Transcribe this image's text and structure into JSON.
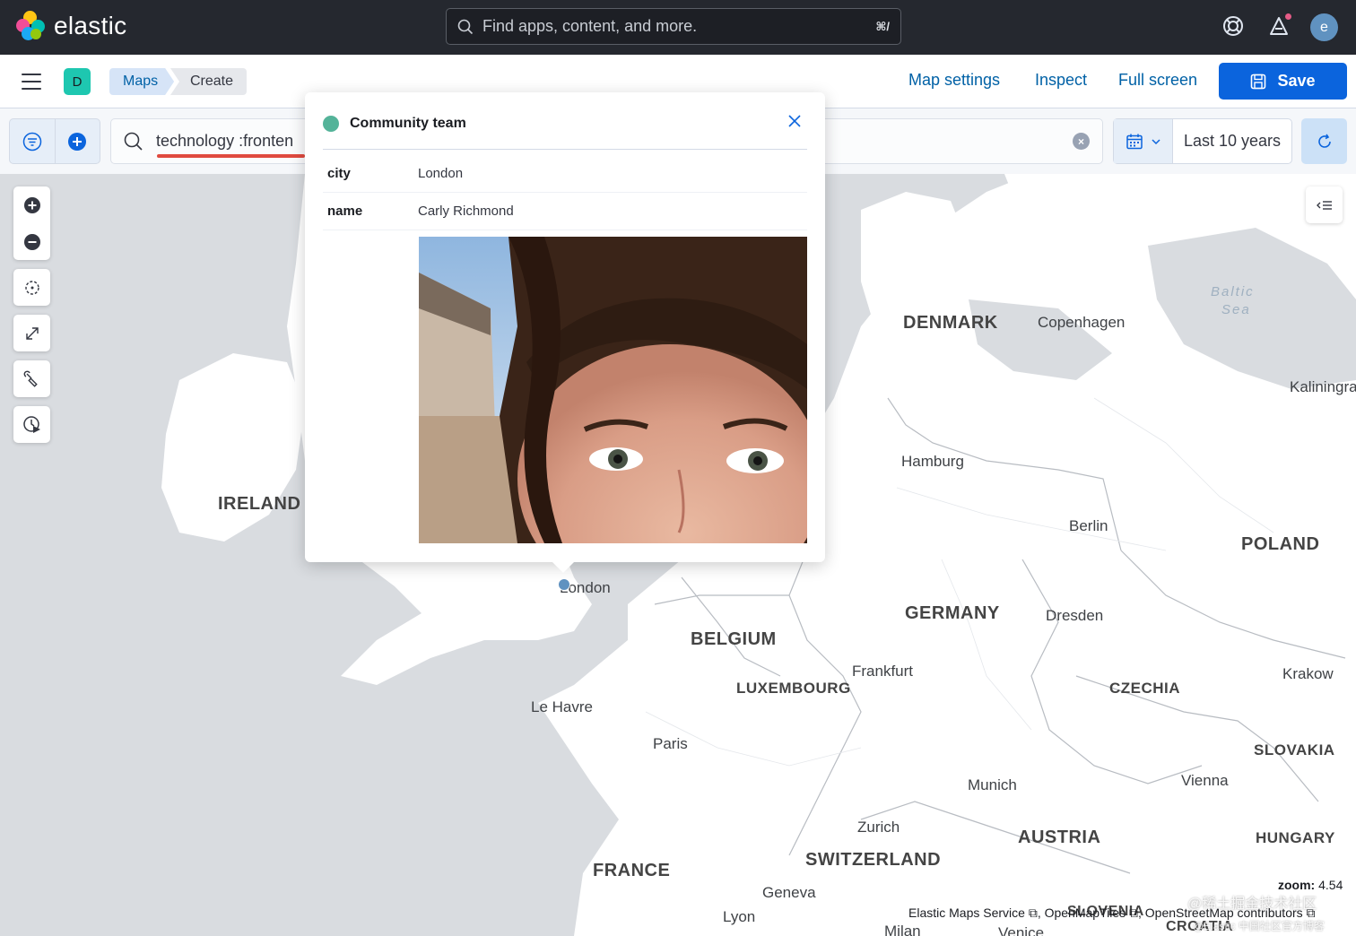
{
  "header": {
    "brand": "elastic",
    "search_placeholder": "Find apps, content, and more.",
    "search_shortcut": "⌘/",
    "avatar_initial": "e"
  },
  "nav": {
    "space_initial": "D",
    "breadcrumbs": [
      "Maps",
      "Create"
    ],
    "links": {
      "map_settings": "Map settings",
      "inspect": "Inspect",
      "full_screen": "Full screen"
    },
    "save_label": "Save"
  },
  "query": {
    "text": "technology :fronten",
    "date_range": "Last 10 years"
  },
  "map": {
    "labels": {
      "countries": {
        "denmark": "DENMARK",
        "ireland": "IRELAND",
        "poland": "POLAND",
        "germany": "GERMANY",
        "belgium": "BELGIUM",
        "luxembourg": "LUXEMBOURG",
        "czechia": "CZECHIA",
        "slovakia": "SLOVAKIA",
        "austria": "AUSTRIA",
        "hungary": "HUNGARY",
        "switzerland": "SWITZERLAND",
        "france": "FRANCE",
        "slovenia": "SLOVENIA",
        "croatia": "CROATIA"
      },
      "cities": {
        "copenhagen": "Copenhagen",
        "kaliningrad": "Kaliningra",
        "hamburg": "Hamburg",
        "berlin": "Berlin",
        "london": "London",
        "dresden": "Dresden",
        "frankfurt": "Frankfurt",
        "krakow": "Krakow",
        "le_havre": "Le Havre",
        "paris": "Paris",
        "munich": "Munich",
        "vienna": "Vienna",
        "zurich": "Zurich",
        "geneva": "Geneva",
        "lyon": "Lyon",
        "milan": "Milan",
        "venice": "Venice"
      },
      "sea_line1": "Baltic",
      "sea_line2": "Sea"
    },
    "zoom_label": "zoom:",
    "zoom_value": "4.54",
    "attribution": "Elastic Maps Service ⧉, OpenMapTiles ⧉, OpenStreetMap contributors ⧉",
    "watermark_line1": "@稀土掘金技术社区",
    "watermark_line2": "@Elastic 中国社区官方博客"
  },
  "popup": {
    "title": "Community team",
    "rows": [
      {
        "key": "city",
        "value": "London"
      },
      {
        "key": "name",
        "value": "Carly Richmond"
      }
    ],
    "legend_color": "#54b399"
  },
  "colors": {
    "header_bg": "#25282f",
    "primary": "#0b64dd",
    "link": "#0061a6",
    "land": "#ffffff",
    "water": "#d9dce0"
  }
}
